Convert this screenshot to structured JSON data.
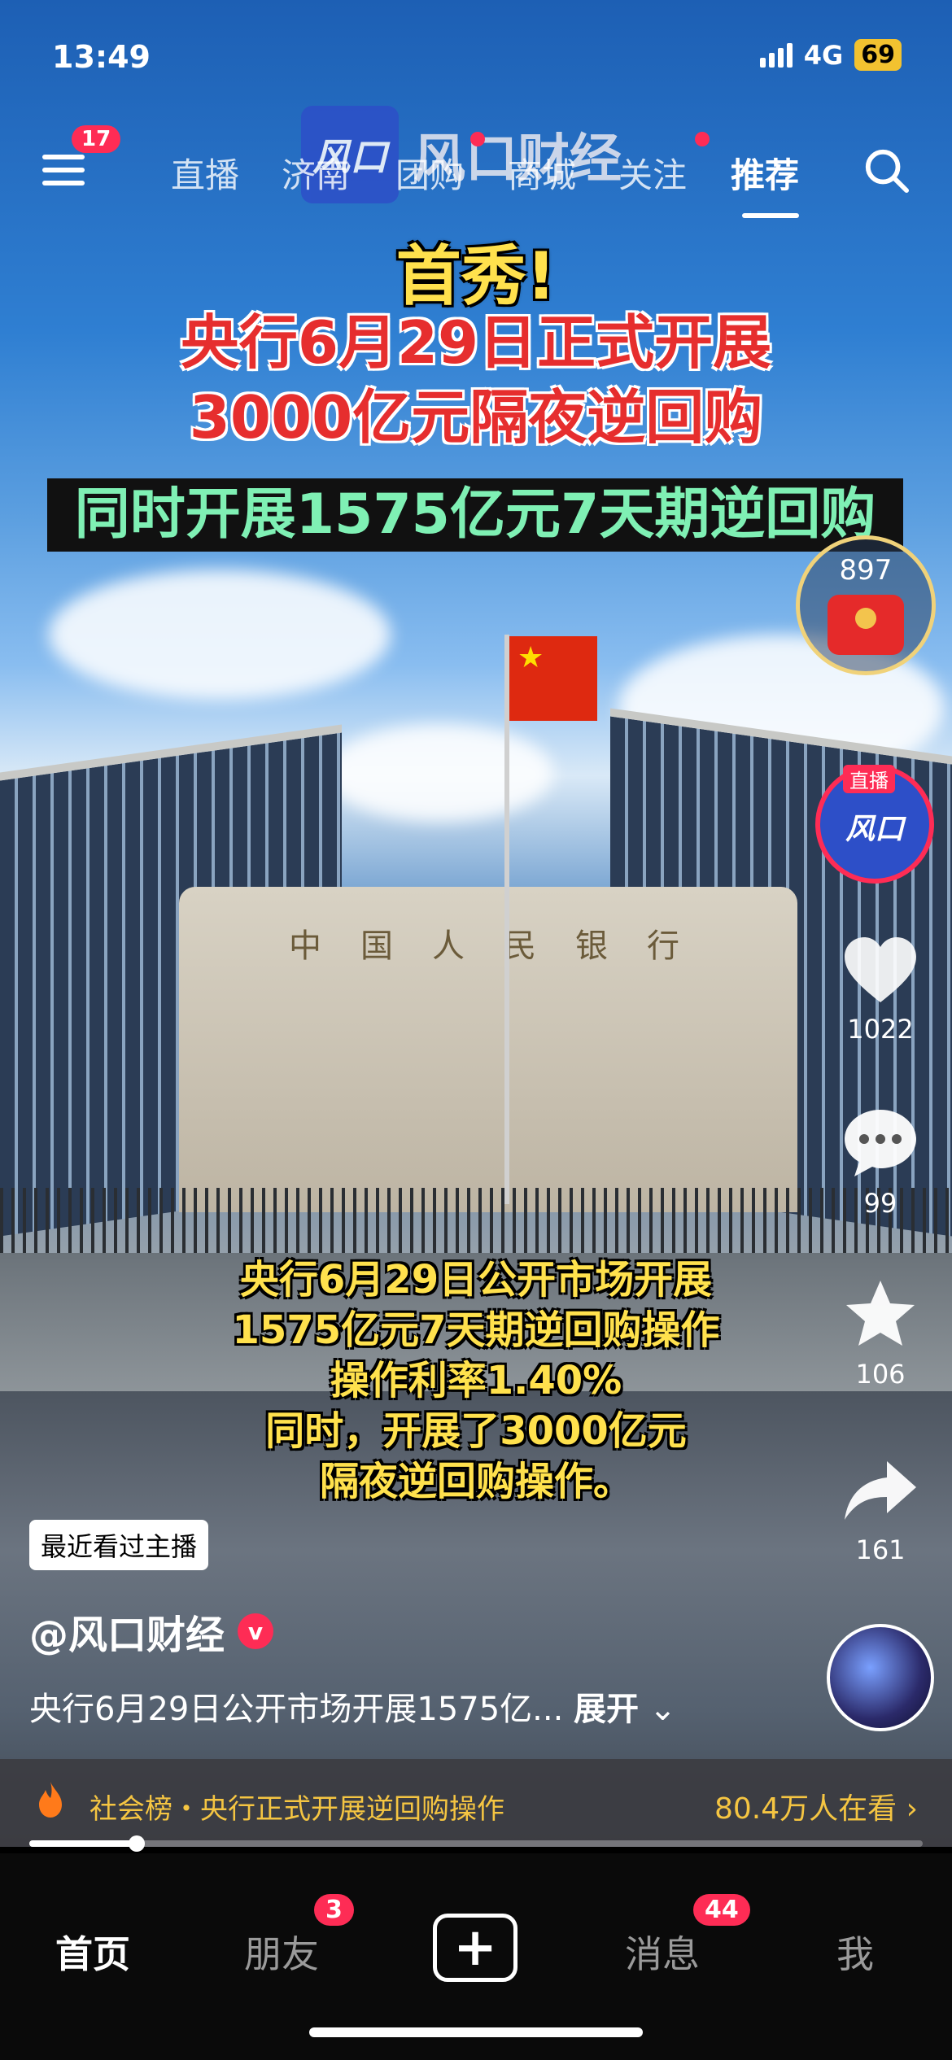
{
  "status_bar": {
    "time": "13:49",
    "network": "4G",
    "battery": "69"
  },
  "top_nav": {
    "menu_badge": "17",
    "tabs": [
      {
        "label": "直播"
      },
      {
        "label": "济南"
      },
      {
        "label": "团购"
      },
      {
        "label": "商城"
      },
      {
        "label": "关注"
      },
      {
        "label": "推荐"
      }
    ],
    "active_tab": "推荐"
  },
  "video": {
    "watermark_logo": "风口",
    "watermark_name": "风口财经",
    "headline_1": "首秀!",
    "headline_2a": "央行6月29日正式开展",
    "headline_2b": "3000亿元隔夜逆回购",
    "headline_3": "同时开展1575亿元7天期逆回购",
    "building_sign": "中国人民银行",
    "caption_lines": [
      "央行6月29日公开市场开展",
      "1575亿元7天期逆回购操作",
      "操作利率1.40%",
      "同时，开展了3000亿元",
      "隔夜逆回购操作。"
    ]
  },
  "side_actions": {
    "red_packet_count": "897",
    "live_tag": "直播",
    "live_logo": "风口",
    "likes": "1022",
    "comments": "99",
    "favorites": "106",
    "shares": "161"
  },
  "info": {
    "recent_tag": "最近看过主播",
    "author": "@风口财经",
    "description": "央行6月29日公开市场开展1575亿...",
    "expand": "展开"
  },
  "hot_bar": {
    "text": "社会榜・央行正式开展逆回购操作",
    "viewers": "80.4万人在看"
  },
  "playback": {
    "progress": 0.12
  },
  "bottom_tabs": {
    "home": "首页",
    "friends": "朋友",
    "friends_badge": "3",
    "messages": "消息",
    "messages_badge": "44",
    "me": "我"
  },
  "colors": {
    "accent": "#fe2c55",
    "hot": "#f5c542"
  }
}
